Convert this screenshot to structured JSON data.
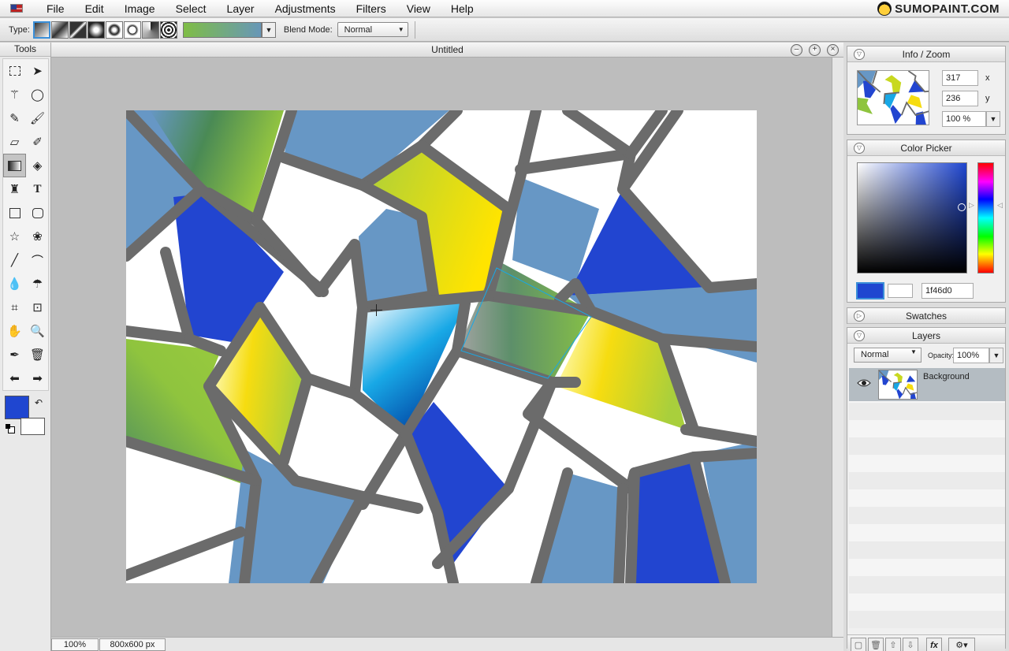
{
  "menubar": {
    "items": [
      "File",
      "Edit",
      "Image",
      "Select",
      "Layer",
      "Adjustments",
      "Filters",
      "View",
      "Help"
    ],
    "brand": "SUMOPAINT.COM"
  },
  "options": {
    "type_label": "Type:",
    "blend_label": "Blend Mode:",
    "blend_value": "Normal"
  },
  "tools": {
    "title": "Tools",
    "items": [
      "marquee-select",
      "move",
      "magic-wand",
      "lasso",
      "pencil",
      "brush",
      "eraser",
      "smudge-brush",
      "gradient",
      "paint-bucket",
      "clone-stamp",
      "text",
      "rectangle",
      "rounded-rectangle",
      "star",
      "flower",
      "line",
      "curve",
      "blur",
      "fill-drops",
      "crop",
      "transform",
      "hand",
      "zoom",
      "eyedropper",
      "trash",
      "arrow-left",
      "arrow-right"
    ],
    "active": "gradient",
    "fg_color": "#1f46d0",
    "bg_color": "#ffffff"
  },
  "document": {
    "title": "Untitled",
    "zoom": "100%",
    "size": "800x600 px"
  },
  "info": {
    "title": "Info / Zoom",
    "x": "317",
    "y": "236",
    "x_label": "x",
    "y_label": "y",
    "zoom": "100 %"
  },
  "color_picker": {
    "title": "Color Picker",
    "hex": "1f46d0"
  },
  "swatches": {
    "title": "Swatches"
  },
  "layers": {
    "title": "Layers",
    "blend": "Normal",
    "opacity_label": "Opacity:",
    "opacity": "100%",
    "items": [
      {
        "name": "Background"
      }
    ]
  },
  "colors": {
    "accent": "#3b8fd8",
    "fg": "#1f46d0",
    "steel": "#6797c5",
    "grout": "#6b6b6b"
  }
}
